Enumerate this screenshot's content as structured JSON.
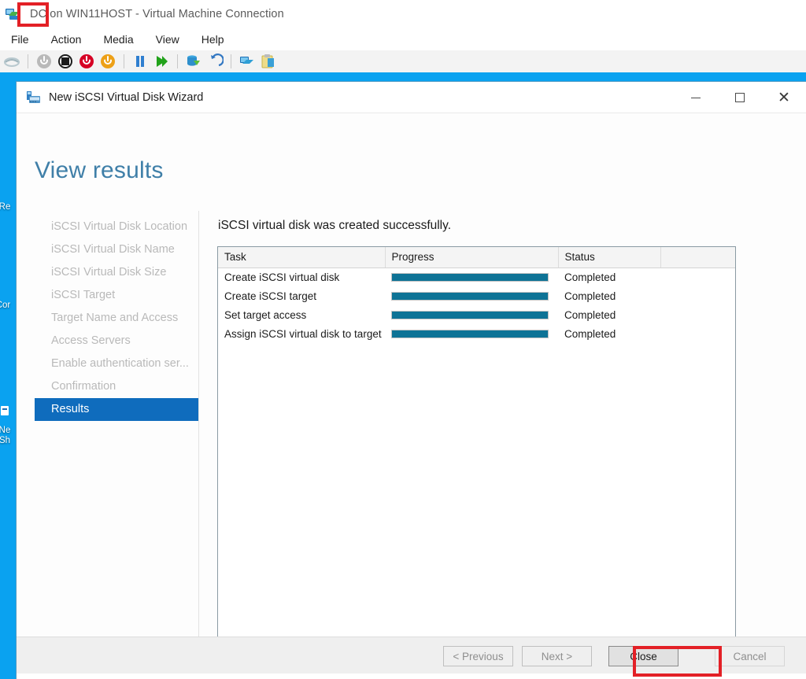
{
  "host_window": {
    "title": "DC on WIN11HOST - Virtual Machine Connection",
    "title_prefix": "DC",
    "title_rest": " on WIN11HOST - Virtual Machine Connection",
    "icon": "virtual-machine-icon",
    "menu": [
      {
        "label": "File"
      },
      {
        "label": "Action"
      },
      {
        "label": "Media"
      },
      {
        "label": "View"
      },
      {
        "label": "Help"
      }
    ],
    "toolbar": [
      {
        "name": "ctrl-alt-del-icon",
        "tip": "Ctrl+Alt+Delete"
      },
      {
        "name": "start-icon",
        "tip": "Start"
      },
      {
        "name": "turn-off-icon",
        "tip": "Turn Off"
      },
      {
        "name": "shut-down-icon",
        "tip": "Shut Down"
      },
      {
        "name": "save-state-icon",
        "tip": "Save"
      },
      {
        "name": "pause-icon",
        "tip": "Pause"
      },
      {
        "name": "resume-icon",
        "tip": "Resume"
      },
      {
        "name": "checkpoint-icon",
        "tip": "Checkpoint"
      },
      {
        "name": "revert-icon",
        "tip": "Revert"
      },
      {
        "name": "enhanced-session-icon",
        "tip": "Enhanced Session"
      },
      {
        "name": "clipboard-icon",
        "tip": "Clipboard"
      }
    ],
    "desktop_icons": [
      {
        "label": "Re",
        "name": "desktop-icon-recycle-bin"
      },
      {
        "label": "Cor",
        "name": "desktop-icon-computer"
      },
      {
        "label": "Ne\nSh",
        "name": "desktop-icon-network-share"
      }
    ],
    "desktop_color": "#0aa2f0"
  },
  "dialog": {
    "title": "New iSCSI Virtual Disk Wizard",
    "icon": "iscsi-disk-icon",
    "window_buttons": {
      "minimize": "minimize-button",
      "maximize": "maximize-button",
      "close": "close-button"
    },
    "page_title": "View results",
    "steps": [
      {
        "label": "iSCSI Virtual Disk Location",
        "active": false
      },
      {
        "label": "iSCSI Virtual Disk Name",
        "active": false
      },
      {
        "label": "iSCSI Virtual Disk Size",
        "active": false
      },
      {
        "label": "iSCSI Target",
        "active": false
      },
      {
        "label": "Target Name and Access",
        "active": false
      },
      {
        "label": "Access Servers",
        "active": false
      },
      {
        "label": "Enable authentication ser...",
        "active": false
      },
      {
        "label": "Confirmation",
        "active": false
      },
      {
        "label": "Results",
        "active": true
      }
    ],
    "results_message": "iSCSI virtual disk was created successfully.",
    "table": {
      "columns": [
        "Task",
        "Progress",
        "Status",
        ""
      ],
      "rows": [
        {
          "task": "Create iSCSI virtual disk",
          "progress": 100,
          "status": "Completed"
        },
        {
          "task": "Create iSCSI target",
          "progress": 100,
          "status": "Completed"
        },
        {
          "task": "Set target access",
          "progress": 100,
          "status": "Completed"
        },
        {
          "task": "Assign iSCSI virtual disk to target",
          "progress": 100,
          "status": "Completed"
        }
      ]
    },
    "buttons": {
      "previous": "< Previous",
      "next": "Next >",
      "close": "Close",
      "cancel": "Cancel"
    }
  },
  "annotations": {
    "color": "#e32026",
    "boxes": [
      {
        "name": "annotation-box-dc-label",
        "target": "DC"
      },
      {
        "name": "annotation-box-close-button",
        "target": "Close"
      }
    ]
  },
  "colors": {
    "accent_blue": "#0f6cbd",
    "title_blue": "#3f7fa8",
    "progress_teal": "#0e7396",
    "desktop_blue": "#0aa2f0",
    "annotation_red": "#e32026"
  }
}
